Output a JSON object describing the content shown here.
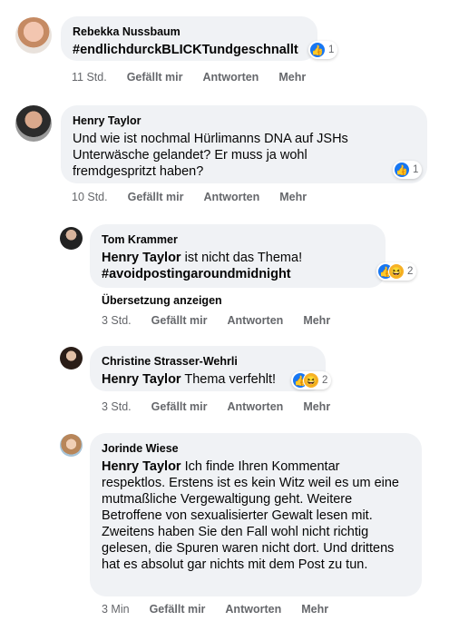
{
  "comments": [
    {
      "author": "Rebekka Nussbaum",
      "text": "#endlichdurckBLICKTundgeschnallt",
      "reactions": {
        "like": true,
        "haha": false,
        "count": "1"
      },
      "time": "11 Std.",
      "like_label": "Gefällt mir",
      "reply_label": "Antworten",
      "more_label": "Mehr"
    },
    {
      "author": "Henry Taylor",
      "text": "Und wie ist nochmal Hürlimanns DNA auf JSHs Unterwäsche gelandet? Er muss ja wohl fremdgespritzt haben?",
      "reactions": {
        "like": true,
        "haha": false,
        "count": "1"
      },
      "time": "10 Std.",
      "like_label": "Gefällt mir",
      "reply_label": "Antworten",
      "more_label": "Mehr"
    },
    {
      "author": "Tom Krammer",
      "mention": "Henry Taylor",
      "text": " ist nicht das Thema!",
      "text2": "#avoidpostingaroundmidnight",
      "reactions": {
        "like": true,
        "haha": true,
        "count": "2"
      },
      "translate": "Übersetzung anzeigen",
      "time": "3 Std.",
      "like_label": "Gefällt mir",
      "reply_label": "Antworten",
      "more_label": "Mehr"
    },
    {
      "author": "Christine Strasser-Wehrli",
      "mention": "Henry Taylor",
      "text": " Thema verfehlt!",
      "reactions": {
        "like": true,
        "haha": true,
        "count": "2"
      },
      "time": "3 Std.",
      "like_label": "Gefällt mir",
      "reply_label": "Antworten",
      "more_label": "Mehr"
    },
    {
      "author": "Jorinde Wiese",
      "mention": "Henry Taylor",
      "text": " Ich finde Ihren Kommentar respektlos. Erstens ist es kein Witz weil es um eine mutmaßliche Vergewaltigung geht. Weitere Betroffene von sexualisierter Gewalt lesen mit. Zweitens haben Sie den Fall wohl nicht richtig gelesen, die Spuren waren nicht dort. Und drittens hat es absolut gar nichts mit dem Post zu tun.",
      "time": "3 Min",
      "like_label": "Gefällt mir",
      "reply_label": "Antworten",
      "more_label": "Mehr"
    }
  ],
  "icons": {
    "like": "thumbs-up-icon",
    "haha": "laughing-face-icon"
  },
  "colors": {
    "bubble": "#f0f2f5",
    "like": "#1877f2",
    "haha": "#f7b125",
    "meta": "#65676b"
  }
}
